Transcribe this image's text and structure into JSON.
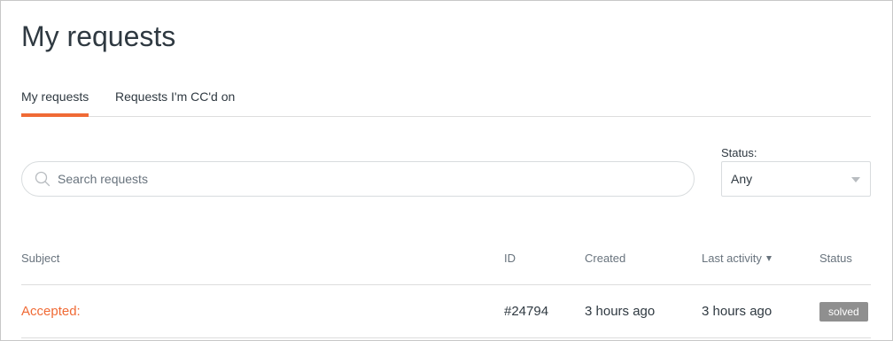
{
  "page": {
    "title": "My requests"
  },
  "tabs": [
    {
      "label": "My requests",
      "active": true
    },
    {
      "label": "Requests I'm CC'd on",
      "active": false
    }
  ],
  "search": {
    "placeholder": "Search requests",
    "value": "",
    "icon": "search-icon"
  },
  "status_filter": {
    "label": "Status:",
    "selected": "Any",
    "icon": "chevron-down-icon"
  },
  "table": {
    "columns": [
      "Subject",
      "ID",
      "Created",
      "Last activity",
      "Status"
    ],
    "sorted_by": "Last activity",
    "sort_direction": "descending",
    "rows": [
      {
        "subject": "Accepted:",
        "id": "#24794",
        "created": "3 hours ago",
        "last_activity": "3 hours ago",
        "status": "solved"
      }
    ]
  },
  "colors": {
    "accent": "#f06a35",
    "text": "#2f3941",
    "muted": "#68737d",
    "border": "#dddddd",
    "badge_solved": "#8f8f8f"
  }
}
